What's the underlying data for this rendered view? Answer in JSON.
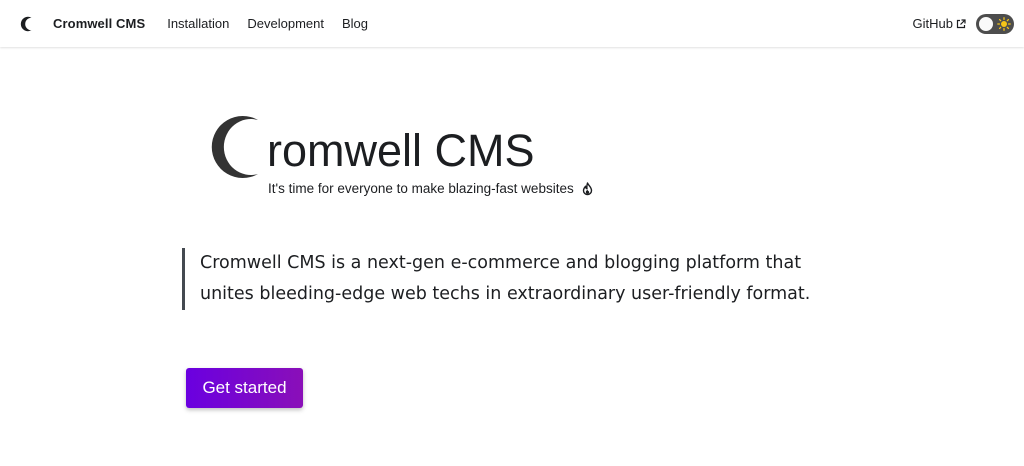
{
  "navbar": {
    "brand_title": "Cromwell CMS",
    "brand_logo_icon": "crescent-logo-icon",
    "links": [
      {
        "label": "Installation"
      },
      {
        "label": "Development"
      },
      {
        "label": "Blog"
      }
    ],
    "github_label": "GitHub",
    "github_icon": "external-link-icon",
    "theme_toggle": {
      "state": "light",
      "icon": "sun-icon"
    }
  },
  "hero": {
    "logo_icon": "crescent-logo-icon",
    "title_rest": "romwell CMS",
    "subtitle": "It's time for everyone to make blazing-fast websites",
    "subtitle_icon": "fire-icon",
    "description_lines": [
      "Cromwell CMS is a next-gen e-commerce and blogging platform that",
      "unites bleeding-edge web techs in extraordinary user-friendly format."
    ],
    "cta_label": "Get started"
  },
  "colors": {
    "text": "#1c1e21",
    "quote_border": "#444950",
    "cta_gradient_start": "#6a00e0",
    "cta_gradient_end": "#8a0fb8",
    "toggle_track": "#4d4d4d",
    "sun": "#f5c518"
  }
}
